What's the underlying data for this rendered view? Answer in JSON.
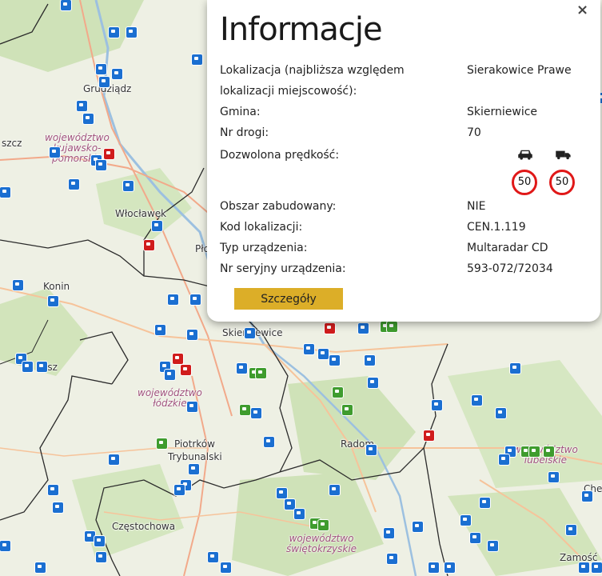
{
  "popup": {
    "title": "Informacje",
    "close": "×",
    "rows": [
      {
        "label": "Lokalizacja (najbliższa względem lokalizacji miejscowość):",
        "value": "Sierakowice Prawe"
      },
      {
        "label": "Gmina:",
        "value": "Skierniewice"
      },
      {
        "label": "Nr drogi:",
        "value": "70"
      },
      {
        "label": "Dozwolona prędkość:",
        "value": ""
      },
      {
        "label": "Obszar zabudowany:",
        "value": "NIE"
      },
      {
        "label": "Kod lokalizacji:",
        "value": "CEN.1.119"
      },
      {
        "label": "Typ urządzenia:",
        "value": "Multaradar CD"
      },
      {
        "label": "Nr seryjny urządzenia:",
        "value": "593-072/72034"
      }
    ],
    "speed_limits": {
      "car": "50",
      "truck": "50",
      "icons": [
        "car-icon",
        "truck-icon"
      ],
      "sign_color": "#e01818"
    },
    "details_button": "Szczegóły",
    "button_color": "#dcae28"
  },
  "map": {
    "places": [
      "Grudziądz",
      "szcz",
      "Włocławek",
      "Płock",
      "Konin",
      "Skierniewice",
      "Piotrków",
      "Trybunalski",
      "Radom",
      "Częstochowa",
      "Zamość",
      "Che",
      "isz"
    ],
    "regions": [
      {
        "lines": [
          "województwo",
          "kujawsko-",
          "pomorskie"
        ]
      },
      {
        "lines": [
          "województwo",
          "łódzkie"
        ]
      },
      {
        "lines": [
          "województwo",
          "świętokrzyskie"
        ]
      },
      {
        "lines": [
          "województwo",
          "lubelskie"
        ]
      }
    ],
    "camera_colors": {
      "blue": "#1b6fd1",
      "green": "#3f9c2e",
      "red": "#d01c1c"
    }
  }
}
